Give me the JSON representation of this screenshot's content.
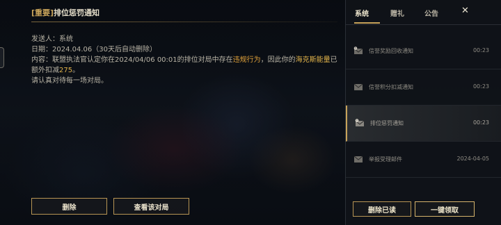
{
  "mail": {
    "tag": "[重要]",
    "title": "排位惩罚通知",
    "sender": "发送人：系统",
    "date": "日期：2024.04.06（30天后自动删除）",
    "content_prefix": "内容：联盟执法官认定你在2024/04/06 00:01的排位对局中存在",
    "violation": "违规行为",
    "content_mid": "，因此你的",
    "energy": "海克斯能量",
    "content_mid2": "已额外扣减",
    "amount": "275",
    "content_suffix": "。",
    "line2": "请认真对待每一场对局。"
  },
  "actions": {
    "delete": "删除",
    "view_match": "查看该对局"
  },
  "tabs": {
    "system": "系统",
    "gift": "赠礼",
    "notice": "公告",
    "close": "✕"
  },
  "list": [
    {
      "label": "信誉奖励回收通知",
      "time": "00:23",
      "icon": "mail-alert-icon",
      "selected": false
    },
    {
      "label": "信誉积分扣减通知",
      "time": "00:23",
      "icon": "mail-icon",
      "selected": false
    },
    {
      "label": "排位惩罚通知",
      "time": "00:23",
      "icon": "mail-alert-icon",
      "selected": true
    },
    {
      "label": "举报受理邮件",
      "time": "2024-04-05",
      "icon": "mail-icon",
      "selected": false
    }
  ],
  "panel_actions": {
    "delete_read": "删除已读",
    "claim_all": "一键领取"
  },
  "colors": {
    "accent": "#c8a35a",
    "highlight": "#e0a13a"
  }
}
